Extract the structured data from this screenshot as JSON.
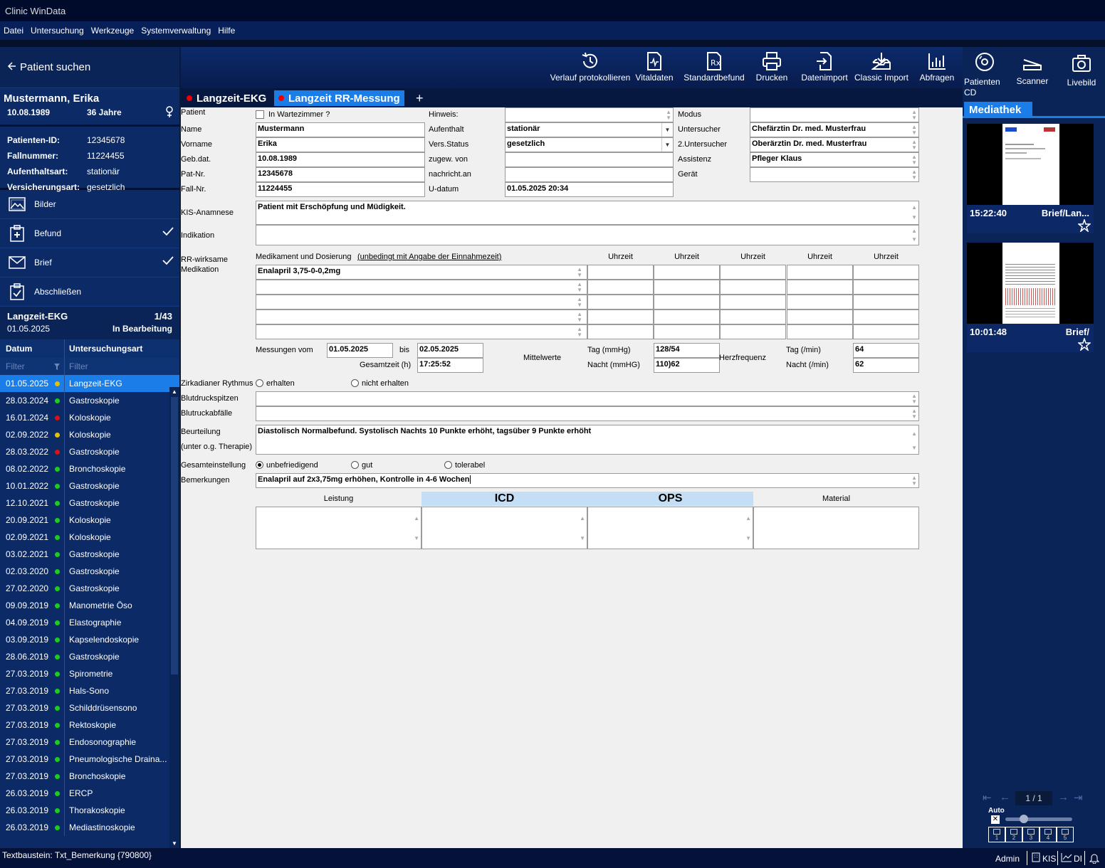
{
  "window": {
    "title": "Clinic WinData"
  },
  "menu": [
    "Datei",
    "Untersuchung",
    "Werkzeuge",
    "Systemverwaltung",
    "Hilfe"
  ],
  "toolbar": {
    "items": [
      "Verlauf protokollieren",
      "Vitaldaten",
      "Standardbefund",
      "Drucken",
      "Datenimport",
      "Classic Import",
      "Abfragen"
    ]
  },
  "right_toolbar": {
    "items": [
      "Patienten CD",
      "Scanner",
      "Livebild"
    ]
  },
  "patient": {
    "search_label": "Patient suchen",
    "name": "Mustermann, Erika",
    "dob": "10.08.1989",
    "age": "36 Jahre",
    "details": [
      {
        "label": "Patienten-ID:",
        "value": "12345678"
      },
      {
        "label": "Fallnummer:",
        "value": "11224455"
      },
      {
        "label": "Aufenthaltsart:",
        "value": "stationär"
      },
      {
        "label": "Versicherungsart:",
        "value": "gesetzlich"
      }
    ]
  },
  "nav": {
    "items": [
      "Bilder",
      "Befund",
      "Brief",
      "Abschließen"
    ]
  },
  "exam": {
    "title": "Langzeit-EKG",
    "counter": "1/43",
    "date": "01.05.2025",
    "status": "In Bearbeitung"
  },
  "table": {
    "col_date": "Datum",
    "col_type": "Untersuchungsart",
    "filter_placeholder": "Filter",
    "rows": [
      {
        "date": "01.05.2025",
        "type": "Langzeit-EKG",
        "status": "#e0c000",
        "selected": true
      },
      {
        "date": "28.03.2024",
        "type": "Gastroskopie",
        "status": "#16d016"
      },
      {
        "date": "16.01.2024",
        "type": "Koloskopie",
        "status": "#e01010"
      },
      {
        "date": "02.09.2022",
        "type": "Koloskopie",
        "status": "#e0c000"
      },
      {
        "date": "28.03.2022",
        "type": "Gastroskopie",
        "status": "#e01010"
      },
      {
        "date": "08.02.2022",
        "type": "Bronchoskopie",
        "status": "#16d016"
      },
      {
        "date": "10.01.2022",
        "type": "Gastroskopie",
        "status": "#16d016"
      },
      {
        "date": "12.10.2021",
        "type": "Gastroskopie",
        "status": "#16d016"
      },
      {
        "date": "20.09.2021",
        "type": "Koloskopie",
        "status": "#16d016"
      },
      {
        "date": "02.09.2021",
        "type": "Koloskopie",
        "status": "#16d016"
      },
      {
        "date": "03.02.2021",
        "type": "Gastroskopie",
        "status": "#16d016"
      },
      {
        "date": "02.03.2020",
        "type": "Gastroskopie",
        "status": "#16d016"
      },
      {
        "date": "27.02.2020",
        "type": "Gastroskopie",
        "status": "#16d016"
      },
      {
        "date": "09.09.2019",
        "type": "Manometrie Öso",
        "status": "#16d016"
      },
      {
        "date": "04.09.2019",
        "type": "Elastographie",
        "status": "#16d016"
      },
      {
        "date": "03.09.2019",
        "type": "Kapselendoskopie",
        "status": "#16d016"
      },
      {
        "date": "28.06.2019",
        "type": "Gastroskopie",
        "status": "#16d016"
      },
      {
        "date": "27.03.2019",
        "type": "Spirometrie",
        "status": "#16d016"
      },
      {
        "date": "27.03.2019",
        "type": "Hals-Sono",
        "status": "#16d016"
      },
      {
        "date": "27.03.2019",
        "type": "Schilddrüsensono",
        "status": "#16d016"
      },
      {
        "date": "27.03.2019",
        "type": "Rektoskopie",
        "status": "#16d016"
      },
      {
        "date": "27.03.2019",
        "type": "Endosonographie",
        "status": "#16d016"
      },
      {
        "date": "27.03.2019",
        "type": "Pneumologische Draina...",
        "status": "#16d016"
      },
      {
        "date": "27.03.2019",
        "type": "Bronchoskopie",
        "status": "#16d016"
      },
      {
        "date": "26.03.2019",
        "type": "ERCP",
        "status": "#16d016"
      },
      {
        "date": "26.03.2019",
        "type": "Thorakoskopie",
        "status": "#16d016"
      },
      {
        "date": "26.03.2019",
        "type": "Mediastinoskopie",
        "status": "#16d016"
      }
    ]
  },
  "tabs": {
    "tab1": "Langzeit-EKG",
    "tab2": "Langzeit RR-Messung",
    "add": "+"
  },
  "form": {
    "lbl": {
      "patient": "Patient",
      "wartezimmer": "In Wartezimmer ?",
      "hinweis": "Hinweis:",
      "modus": "Modus",
      "name": "Name",
      "aufenthalt": "Aufenthalt",
      "untersucher": "Untersucher",
      "vorname": "Vorname",
      "versstatus": "Vers.Status",
      "untersucher2": "2.Untersucher",
      "gebdat": "Geb.dat.",
      "zugew": "zugew. von",
      "assistenz": "Assistenz",
      "patnr": "Pat-Nr.",
      "nachricht": "nachricht.an",
      "geraet": "Gerät",
      "fallnr": "Fall-Nr.",
      "udatum": "U-datum",
      "kis": "KIS-Anamnese",
      "indikation": "Indikation",
      "rr1": "RR-wirksame",
      "rr2": "Medikation",
      "med_header": "Medikament und Dosierung",
      "med_note": "(unbedingt mit Angabe der Einnahmezeit)",
      "uhrzeit": "Uhrzeit",
      "messungen": "Messungen vom",
      "bis": "bis",
      "gesamtzeit": "Gesamtzeit (h)",
      "mittelwerte": "Mittelwerte",
      "tag_mmhg": "Tag (mmHg)",
      "nacht_mmhg": "Nacht (mmHG)",
      "herzfrequenz": "Herzfrequenz",
      "tag_min": "Tag (/min)",
      "nacht_min": "Nacht (/min)",
      "zirkadian": "Zirkadianer Rythmus",
      "erhalten": "erhalten",
      "nicht_erhalten": "nicht erhalten",
      "spitzen": "Blutdruckspitzen",
      "abfaelle": "Blutruckabfälle",
      "beurteilung": "Beurteilung",
      "therapie": "(unter o.g. Therapie)",
      "gesamt": "Gesamteinstellung",
      "unbefriedigend": "unbefriedigend",
      "gut": "gut",
      "tolerabel": "tolerabel",
      "bemerkungen": "Bemerkungen",
      "leistung": "Leistung",
      "icd": "ICD",
      "ops": "OPS",
      "material": "Material"
    },
    "val": {
      "name": "Mustermann",
      "aufenthalt": "stationär",
      "untersucher": "Chefärztin Dr. med. Musterfrau",
      "vorname": "Erika",
      "versstatus": "gesetzlich",
      "untersucher2": "Oberärztin Dr. med. Musterfrau",
      "gebdat": "10.08.1989",
      "assistenz": "Pfleger Klaus",
      "patnr": "12345678",
      "fallnr": "11224455",
      "udatum": "01.05.2025 20:34",
      "kis": "Patient mit Erschöpfung und Müdigkeit.",
      "medikament": "Enalapril 3,75-0-0,2mg",
      "von": "01.05.2025",
      "bis": "02.05.2025",
      "gesamtzeit": "17:25:52",
      "tag_mmhg": "128/54",
      "nacht_mmhg": "110)62",
      "tag_min": "64",
      "nacht_min": "62",
      "beurteilung": "Diastolisch Normalbefund. Systolisch Nachts 10 Punkte erhöht, tagsüber 9 Punkte erhöht",
      "bemerkungen": "Enalapril auf 2x3,75mg erhöhen, Kontrolle in 4-6 Wochen"
    }
  },
  "mediathek": {
    "title": "Mediathek",
    "items": [
      {
        "time": "15:22:40",
        "label": "Brief/Lan..."
      },
      {
        "time": "10:01:48",
        "label": "Brief/"
      }
    ],
    "pager": "1 / 1",
    "auto": "Auto",
    "slots": [
      "1",
      "2",
      "3",
      "4",
      "5"
    ]
  },
  "status": {
    "text": "Textbaustein: Txt_Bemerkung {790800}",
    "user": "Admin",
    "kis": "KIS",
    "di": "DI"
  }
}
